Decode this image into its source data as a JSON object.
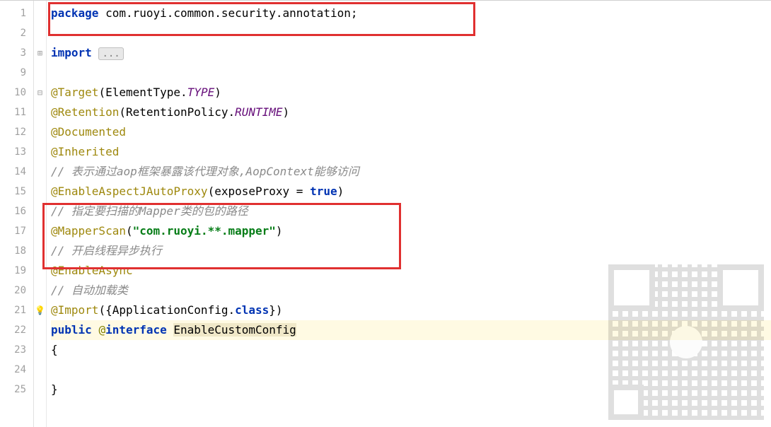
{
  "lineNumbers": [
    "1",
    "2",
    "3",
    "9",
    "10",
    "11",
    "12",
    "13",
    "14",
    "15",
    "16",
    "17",
    "18",
    "19",
    "20",
    "21",
    "22",
    "23",
    "24",
    "25"
  ],
  "l1": {
    "package": "package ",
    "pkg": "com.ruoyi.common.security.annotation",
    "semi": ";"
  },
  "l3": {
    "import": "import ",
    "dots": "..."
  },
  "l10": {
    "anno": "@Target",
    "lp": "(",
    "t": "ElementType",
    "dot": ".",
    "m": "TYPE",
    "rp": ")"
  },
  "l11": {
    "anno": "@Retention",
    "lp": "(",
    "t": "RetentionPolicy",
    "dot": ".",
    "m": "RUNTIME",
    "rp": ")"
  },
  "l12": {
    "anno": "@Documented"
  },
  "l13": {
    "anno": "@Inherited"
  },
  "l14": {
    "c": "// 表示通过aop框架暴露该代理对象,AopContext能够访问"
  },
  "l15": {
    "anno": "@EnableAspectJAutoProxy",
    "lp": "(",
    "p": "exposeProxy = ",
    "v": "true",
    "rp": ")"
  },
  "l16": {
    "c": "// 指定要扫描的Mapper类的包的路径"
  },
  "l17": {
    "anno": "@MapperScan",
    "lp": "(",
    "s": "\"com.ruoyi.**.mapper\"",
    "rp": ")"
  },
  "l18": {
    "c": "// 开启线程异步执行"
  },
  "l19": {
    "anno": "@EnableAsync"
  },
  "l20": {
    "c": "// 自动加载类"
  },
  "l21": {
    "anno": "@Import",
    "lp": "({",
    "t": "ApplicationConfig",
    "dot": ".",
    "cls": "class",
    "rp": "})"
  },
  "l22": {
    "pub": "public ",
    "at": "@",
    "intf": "interface ",
    "name": "EnableCustomConfig"
  },
  "l23": {
    "b": "{"
  },
  "l25": {
    "b": "}"
  }
}
